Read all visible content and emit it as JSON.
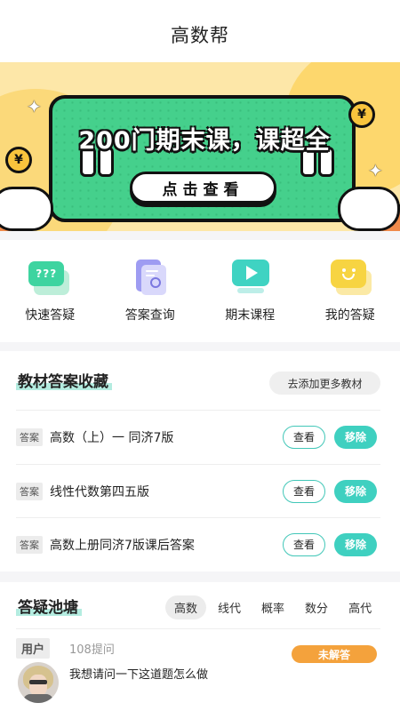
{
  "header": {
    "title": "高数帮"
  },
  "banner": {
    "headline": "200门期末课，课超全",
    "cta_label": "点击查看",
    "coin_symbol": "¥"
  },
  "features": [
    {
      "label": "快速答疑",
      "icon": "chat-bubble-question-icon",
      "icon_text": "???"
    },
    {
      "label": "答案查询",
      "icon": "document-search-icon"
    },
    {
      "label": "期末课程",
      "icon": "video-play-icon"
    },
    {
      "label": "我的答疑",
      "icon": "smiley-chat-icon"
    }
  ],
  "books": {
    "title": "教材答案收藏",
    "add_label": "去添加更多教材",
    "items": [
      {
        "tag": "答案",
        "name": "高数（上）一 同济7版",
        "view_label": "查看",
        "remove_label": "移除"
      },
      {
        "tag": "答案",
        "name": "线性代数第四五版",
        "view_label": "查看",
        "remove_label": "移除"
      },
      {
        "tag": "答案",
        "name": "高数上册同济7版课后答案",
        "view_label": "查看",
        "remove_label": "移除"
      }
    ]
  },
  "pond": {
    "title": "答疑池塘",
    "tabs": [
      "高数",
      "线代",
      "概率",
      "数分",
      "高代"
    ],
    "active_tab": "高数",
    "question": {
      "user": "用户",
      "count": "108提问",
      "status": "未解答",
      "text": "我想请问一下这道题怎么做"
    }
  },
  "colors": {
    "accent": "#3fd0c0",
    "banner_green": "#45d08c",
    "banner_yellow": "#fde7a8",
    "status_orange": "#f4a23c",
    "highlight": "#b4ece0"
  }
}
